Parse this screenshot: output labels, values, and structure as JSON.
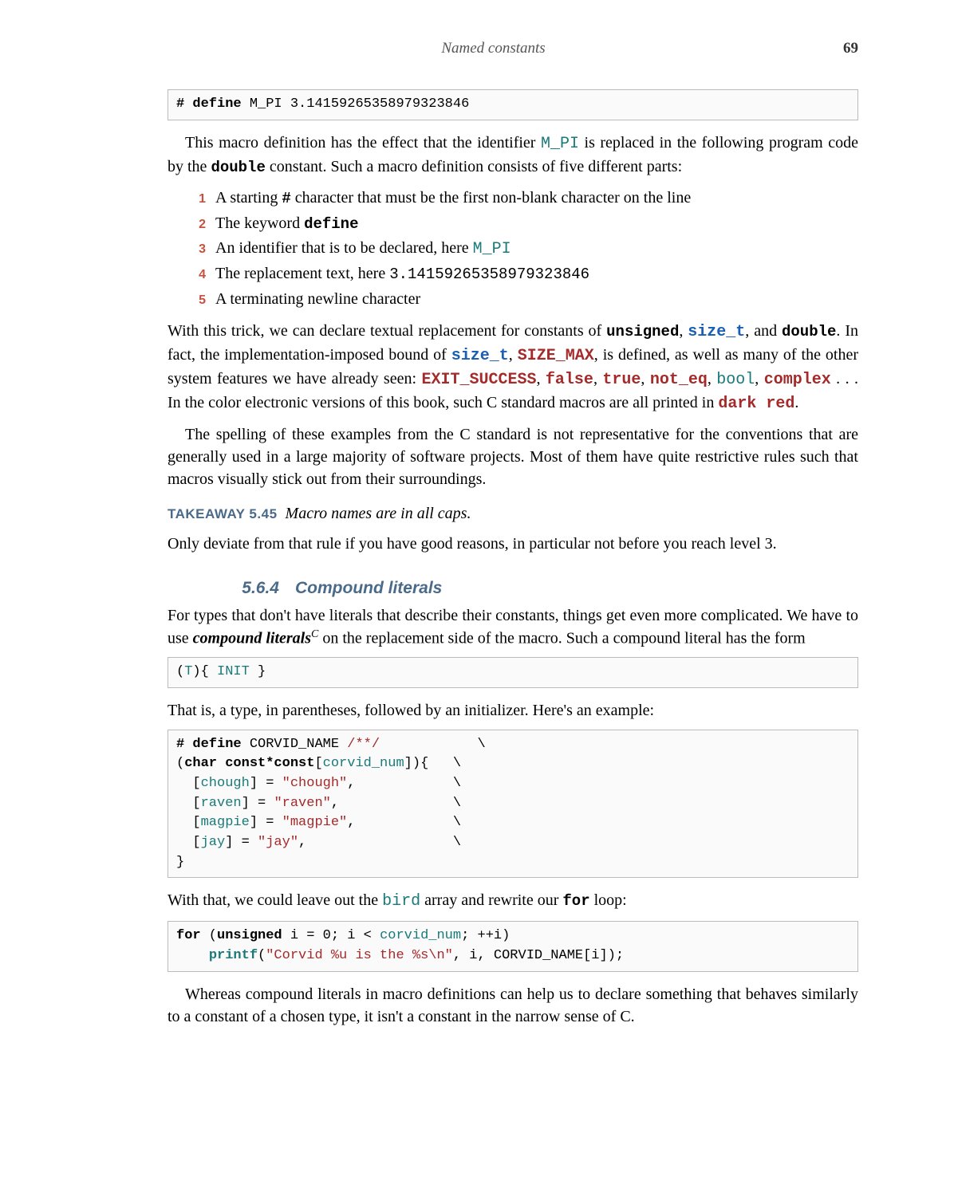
{
  "header": {
    "title": "Named constants",
    "page_number": "69"
  },
  "code_define_mpi": {
    "hash": "#",
    "define": "define",
    "rest": " M_PI 3.14159265358979323846"
  },
  "para1": {
    "a": "This macro definition has the effect that the identifier ",
    "mpi": "M_PI",
    "b": " is replaced in the following program code by the ",
    "double": "double",
    "c": " constant. Such a macro definition consists of five different parts:"
  },
  "list": {
    "n1": "1",
    "t1a": "A starting ",
    "t1b": "#",
    "t1c": " character that must be the first non-blank character on the line",
    "n2": "2",
    "t2a": "The keyword ",
    "t2b": "define",
    "n3": "3",
    "t3a": "An identifier that is to be declared, here ",
    "t3b": "M_PI",
    "n4": "4",
    "t4a": "The replacement text, here ",
    "t4b": "3.14159265358979323846",
    "n5": "5",
    "t5": "A terminating newline character"
  },
  "para2": {
    "a": "With this trick, we can declare textual replacement for constants of ",
    "unsigned": "unsigned",
    "c1": ", ",
    "size_t1": "size_t",
    "c2": ", and ",
    "double": "double",
    "b": ". In fact, the implementation-imposed bound of ",
    "size_t2": "size_t",
    "c3": ", ",
    "size_max": "SIZE_MAX",
    "c": ", is defined, as well as many of the other system features we have already seen: ",
    "exit": "EXIT_SUCCESS",
    "c4": ", ",
    "false": "false",
    "c5": ", ",
    "true": "true",
    "c6": ", ",
    "noteq": "not_eq",
    "c7": ", ",
    "bool": "bool",
    "c8": ", ",
    "complex": "complex",
    "d": " . . . In the color electronic versions of this book, such C standard macros are all printed in ",
    "darkred": "dark red",
    "e": "."
  },
  "para3": "The spelling of these examples from the C standard is not representative for the conventions that are generally used in a large majority of software projects. Most of them have quite restrictive rules such that macros visually stick out from their surroundings.",
  "takeaway": {
    "label": "TAKEAWAY 5.45",
    "text": "Macro names are in all caps."
  },
  "para4": "Only deviate from that rule if you have good reasons, in particular not before you reach level 3.",
  "section": {
    "num": "5.6.4",
    "title": "Compound literals"
  },
  "para5": {
    "a": "For types that don't have literals that describe their constants, things get even more complicated. We have to use ",
    "term": "compound literals",
    "sup": "C",
    "b": " on the replacement side of the macro. Such a compound literal has the form"
  },
  "code_form": {
    "a": "(",
    "T": "T",
    "b": "){ ",
    "init": "INIT",
    "c": " }"
  },
  "para6": "That is, a type, in parentheses, followed by an initializer. Here's an example:",
  "code_corvid": {
    "l1": {
      "hash": "#",
      "def": " define",
      "name": " CORVID_NAME ",
      "cmt": "/**/",
      "tail": "            \\"
    },
    "l2": {
      "a": "(",
      "kw": "char const*const",
      "b": "[",
      "id": "corvid_num",
      "c": "]){   \\"
    },
    "l3": {
      "a": "  [",
      "id": "chough",
      "b": "] = ",
      "s": "\"chough\"",
      "c": ",            \\"
    },
    "l4": {
      "a": "  [",
      "id": "raven",
      "b": "] = ",
      "s": "\"raven\"",
      "c": ",              \\"
    },
    "l5": {
      "a": "  [",
      "id": "magpie",
      "b": "] = ",
      "s": "\"magpie\"",
      "c": ",            \\"
    },
    "l6": {
      "a": "  [",
      "id": "jay",
      "b": "] = ",
      "s": "\"jay\"",
      "c": ",                  \\"
    },
    "l7": "}"
  },
  "para7": {
    "a": "With that, we could leave out the ",
    "bird": "bird",
    "b": " array and rewrite our ",
    "for": "for",
    "c": " loop:"
  },
  "code_for": {
    "l1": {
      "for": "for",
      "a": " (",
      "uns": "unsigned",
      "b": " i = 0; i < ",
      "cn": "corvid_num",
      "c": "; ++i)"
    },
    "l2": {
      "sp": "    ",
      "pf": "printf",
      "a": "(",
      "s1": "\"Corvid %u is the %s\\n\"",
      "b": ", i, CORVID_NAME[i]);"
    }
  },
  "para8": "Whereas compound literals in macro definitions can help us to declare something that behaves similarly to a constant of a chosen type, it isn't a constant in the narrow sense of C."
}
